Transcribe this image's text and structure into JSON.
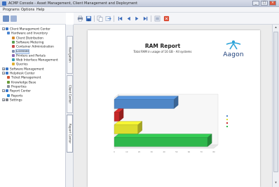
{
  "window": {
    "title": "ACMP Console - Asset Management, Client Management and Deployment",
    "controls": {
      "minimize": "_",
      "maximize": "□",
      "close": "×"
    }
  },
  "menu": [
    "Programs",
    "Options",
    "Help"
  ],
  "tree": [
    {
      "label": "Client Management Center",
      "level": 0,
      "expand": "−",
      "icon": "monitor-icon",
      "color": "#3a76c8",
      "selected": false
    },
    {
      "label": "Hardware and Inventory",
      "level": 1,
      "expand": "",
      "icon": "chip-icon",
      "color": "#4b85d1",
      "selected": false
    },
    {
      "label": "Client Distribution",
      "level": 2,
      "expand": "",
      "icon": "package-icon",
      "color": "#d48a2a",
      "selected": false
    },
    {
      "label": "Software Metering",
      "level": 2,
      "expand": "",
      "icon": "meter-icon",
      "color": "#5ca054",
      "selected": false
    },
    {
      "label": "Container Administration",
      "level": 2,
      "expand": "",
      "icon": "container-icon",
      "color": "#c94d4d",
      "selected": false
    },
    {
      "label": "Licenses",
      "level": 2,
      "expand": "",
      "icon": "license-icon",
      "color": "#7e8fb0",
      "selected": true
    },
    {
      "label": "Printers and Portals",
      "level": 2,
      "expand": "",
      "icon": "printer-icon",
      "color": "#8a6bb5",
      "selected": false
    },
    {
      "label": "Web Interface Management",
      "level": 2,
      "expand": "",
      "icon": "web-icon",
      "color": "#3a9cb0",
      "selected": false
    },
    {
      "label": "Queries",
      "level": 2,
      "expand": "",
      "icon": "query-icon",
      "color": "#e0b030",
      "selected": false
    },
    {
      "label": "Software Management",
      "level": 0,
      "expand": "+",
      "icon": "software-icon",
      "color": "#3a76c8",
      "selected": false
    },
    {
      "label": "Helpdesk Center",
      "level": 0,
      "expand": "−",
      "icon": "helpdesk-icon",
      "color": "#3a76c8",
      "selected": false
    },
    {
      "label": "Ticket Management",
      "level": 1,
      "expand": "",
      "icon": "ticket-icon",
      "color": "#d05a3a",
      "selected": false
    },
    {
      "label": "Knowledge Base",
      "level": 1,
      "expand": "",
      "icon": "book-icon",
      "color": "#6a9c3a",
      "selected": false
    },
    {
      "label": "Properties",
      "level": 1,
      "expand": "",
      "icon": "properties-icon",
      "color": "#8a8f99",
      "selected": false
    },
    {
      "label": "Report Center",
      "level": 0,
      "expand": "−",
      "icon": "report-icon",
      "color": "#3a76c8",
      "selected": false
    },
    {
      "label": "Reports",
      "level": 1,
      "expand": "",
      "icon": "chart-icon",
      "color": "#2f8ad6",
      "selected": false
    },
    {
      "label": "Settings",
      "level": 0,
      "expand": "+",
      "icon": "settings-icon",
      "color": "#7b7f88",
      "selected": false
    }
  ],
  "vertical_tabs": [
    "Navigation",
    "Client Center",
    "Report Center"
  ],
  "report_toolbar": {
    "tools": [
      "print-icon",
      "save-icon",
      "copy-icon",
      "export-icon",
      "first-page-icon",
      "prev-page-icon",
      "next-page-icon",
      "last-page-icon",
      "zoom-icon",
      "close-report-icon"
    ]
  },
  "report": {
    "title": "RAM Report",
    "subtitle": "Total RAM in usage of 16 GB - All systems",
    "logo_text": "Aagon"
  },
  "chart_data": {
    "type": "bar",
    "orientation": "horizontal",
    "style": "3d",
    "categories": [
      "",
      "",
      "",
      ""
    ],
    "series": [
      {
        "values": [
          48,
          4,
          19,
          75
        ],
        "colors": [
          "#4f86c6",
          "#c62828",
          "#dcdc2e",
          "#2fb74c"
        ]
      }
    ],
    "xlim": [
      0,
      80
    ],
    "x_tick_labels": [
      "0",
      "10",
      "20",
      "30",
      "40",
      "50",
      "60",
      "70",
      "80"
    ],
    "legend": [
      "",
      "",
      "",
      ""
    ],
    "legend_colors": [
      "#4f86c6",
      "#dcdc2e",
      "#c62828",
      "#2fb74c"
    ],
    "legend_position": "right",
    "grid": false
  }
}
